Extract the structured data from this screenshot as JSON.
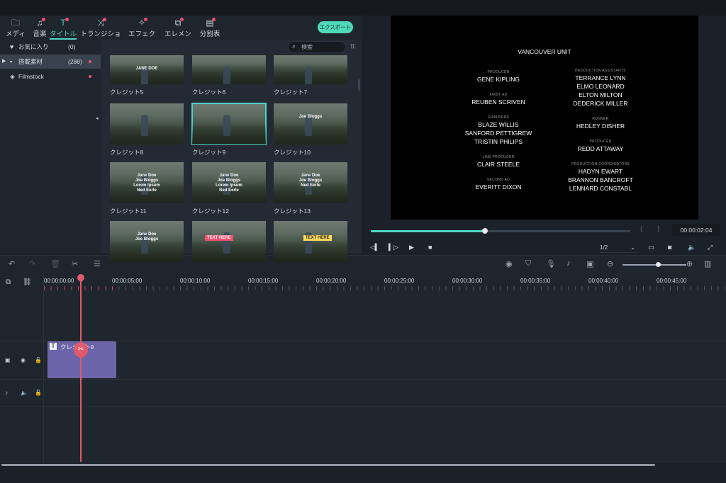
{
  "tabs": [
    {
      "label": "メディア",
      "icon": "folder-icon",
      "glyph": "🗀",
      "dot": false,
      "active": false
    },
    {
      "label": "音楽",
      "icon": "music-note-icon",
      "glyph": "♫",
      "dot": true,
      "active": false
    },
    {
      "label": "タイトル",
      "icon": "title-t-icon",
      "glyph": "T",
      "dot": true,
      "active": true
    },
    {
      "label": "トランジション",
      "icon": "transition-icon",
      "glyph": "⤨",
      "dot": true,
      "active": false
    },
    {
      "label": "エフェクト",
      "icon": "effect-sparkle-icon",
      "glyph": "✧",
      "dot": true,
      "active": false
    },
    {
      "label": "エレメント",
      "icon": "element-icon",
      "glyph": "⧉",
      "dot": true,
      "active": false
    },
    {
      "label": "分割表示",
      "icon": "split-screen-icon",
      "glyph": "▤",
      "dot": true,
      "active": false
    }
  ],
  "export_label": "エクスポート",
  "sidebar": [
    {
      "label": "お気に入り",
      "count": "(0)",
      "icon": "heart-icon",
      "glyph": "♥",
      "arrow": "",
      "dot": false,
      "selected": false
    },
    {
      "label": "搭載素材",
      "count": "(288)",
      "icon": "folder-icon",
      "glyph": "▪",
      "arrow": "▶",
      "dot": true,
      "selected": true
    },
    {
      "label": "Filmstock",
      "count": "",
      "icon": "filmstock-icon",
      "glyph": "◈",
      "arrow": "",
      "dot": true,
      "selected": false
    }
  ],
  "search": {
    "placeholder": "検索"
  },
  "thumbnails": [
    {
      "label": "クレジット5",
      "caption": "JANE DOE",
      "style": "text",
      "selected": false
    },
    {
      "label": "クレジット6",
      "caption": "",
      "style": "plain",
      "selected": false
    },
    {
      "label": "クレジット7",
      "caption": "",
      "style": "plain",
      "selected": false
    },
    {
      "label": "クレジット8",
      "caption": "",
      "style": "plain",
      "selected": false
    },
    {
      "label": "クレジット9",
      "caption": "",
      "style": "plain",
      "selected": true
    },
    {
      "label": "クレジット10",
      "caption": "Joe Bloggs",
      "style": "text",
      "selected": false
    },
    {
      "label": "クレジット11",
      "caption": "Jane Doe\nJoe Bloggs\nLorem Ipsum\nNed Eerle",
      "style": "text",
      "selected": false
    },
    {
      "label": "クレジット12",
      "caption": "Jane Doe\nJoe Bloggs\nLorem Ipsum\nNed Eerle",
      "style": "text",
      "selected": false
    },
    {
      "label": "クレジット13",
      "caption": "Jane Doe\nJoe Bloggs\nNed Eerle",
      "style": "text",
      "selected": false
    },
    {
      "label": "",
      "caption": "Jane Doe\nJoe Bloggs",
      "style": "text",
      "selected": false
    },
    {
      "label": "",
      "caption": "TEXT HERE",
      "style": "pink",
      "selected": false
    },
    {
      "label": "",
      "caption": "TEXT HERE",
      "style": "yellow",
      "selected": false
    }
  ],
  "credits": {
    "heading": "VANCOUVER UNIT",
    "left": [
      {
        "role": "PRODUCER",
        "names": [
          "GENE KIPLING"
        ]
      },
      {
        "role": "FIRST AD",
        "names": [
          "REUBEN SCRIVEN"
        ]
      },
      {
        "role": "GRAPPERS",
        "names": [
          "BLAZE WILLIS",
          "SANFORD PETTIGREW",
          "TRISTIN PHILIPS"
        ]
      },
      {
        "role": "LINE PRODUCER",
        "names": [
          "CLAIR STEELE"
        ]
      },
      {
        "role": "SECOND AD",
        "names": [
          "EVERITT DIXON"
        ]
      }
    ],
    "right": [
      {
        "role": "PRODUCTION ASSISTANTS",
        "names": [
          "TERRANCE LYNN",
          "ELMO LEONARD",
          "ELTON MILTON",
          "DEDERICK MILLER"
        ]
      },
      {
        "role": "RUNNER",
        "names": [
          "HEDLEY DISHER"
        ]
      },
      {
        "role": "PRODUCER",
        "names": [
          "REDD ATTAWAY"
        ]
      },
      {
        "role": "PRODUCTION COORDINATORS",
        "names": [
          "HADYN EWART",
          "BRANNON BANCROFT",
          "LENNARD CONSTABL"
        ]
      }
    ]
  },
  "player": {
    "timecode": "00:00:02:04",
    "progress": 0.44,
    "ratio": "1/2",
    "mark_in": "{",
    "mark_out": "}"
  },
  "ruler": [
    "00:00:00:00",
    "00:00:05:00",
    "00:00:10:00",
    "00:00:15:00",
    "00:00:20:00",
    "00:00:25:00",
    "00:00:30:00",
    "00:00:35:00",
    "00:00:40:00",
    "00:00:45:00"
  ],
  "clip": {
    "label": "クレジット9",
    "icon_text": "T"
  },
  "zoom": 0.55
}
